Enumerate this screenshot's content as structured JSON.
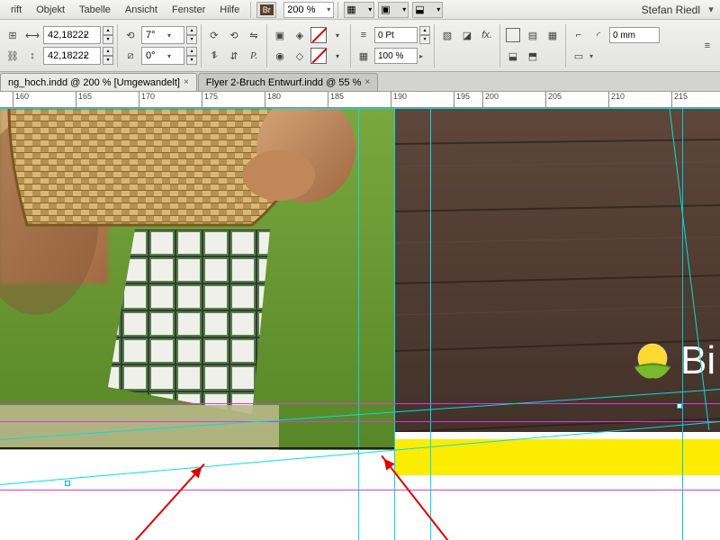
{
  "menu": {
    "items": [
      "rift",
      "Objekt",
      "Tabelle",
      "Ansicht",
      "Fenster",
      "Hilfe"
    ],
    "br": "Br",
    "zoom": "200 %"
  },
  "user": "Stefan Riedl",
  "toolbar": {
    "a1": "42,18222",
    "a2": "42,18222",
    "r1": "7°",
    "r2": "0°",
    "pt": "0 Pt",
    "pct": "100 %",
    "mm": "0 mm"
  },
  "tabs": {
    "t1": "ng_hoch.indd @ 200 % [Umgewandelt]",
    "t2": "Flyer 2-Bruch Entwurf.indd @ 55 %"
  },
  "ruler": {
    "vals": [
      "160",
      "165",
      "170",
      "175",
      "180",
      "185",
      "190",
      "195",
      "200",
      "205",
      "210",
      "215"
    ]
  },
  "logo_text": "Bi"
}
